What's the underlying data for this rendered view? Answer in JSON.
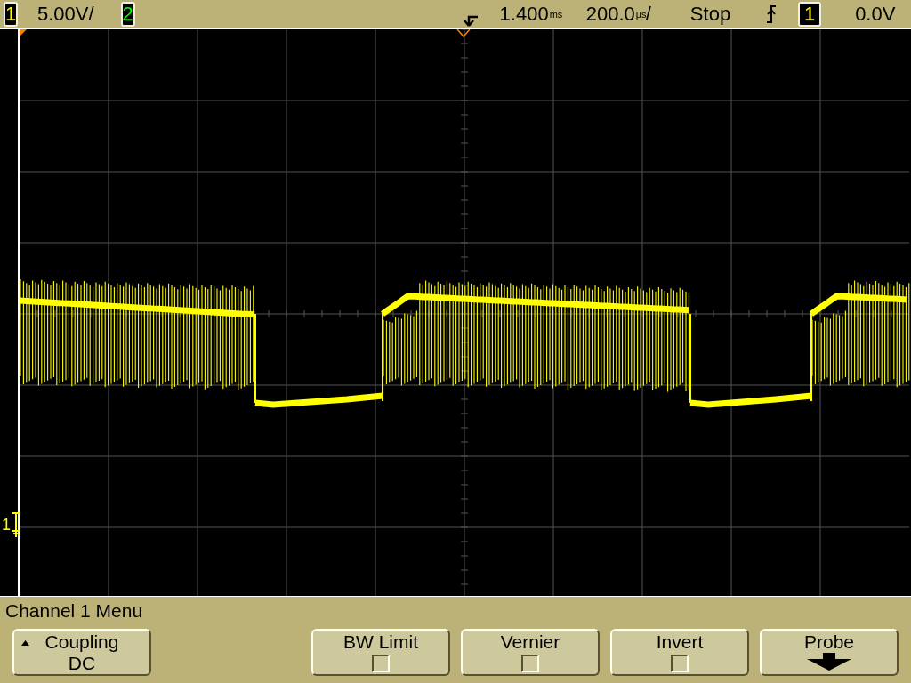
{
  "top_bar": {
    "channels": [
      {
        "label": "1",
        "scale": "5.00V/"
      },
      {
        "label": "2"
      }
    ],
    "delay": {
      "value": "1.400",
      "unit": "ms"
    },
    "timebase": {
      "value": "200.0",
      "unit": "µs",
      "suffix": "/"
    },
    "run_state": "Stop",
    "trigger": {
      "source": "1",
      "level": "0.0V"
    }
  },
  "display": {
    "ground_marker": "1"
  },
  "menu": {
    "title": "Channel 1 Menu",
    "softkeys": [
      {
        "kind": "value",
        "label": "Coupling",
        "value": "DC"
      },
      {
        "kind": "empty"
      },
      {
        "kind": "checkbox",
        "label": "BW Limit",
        "checked": false
      },
      {
        "kind": "checkbox",
        "label": "Vernier",
        "checked": false
      },
      {
        "kind": "checkbox",
        "label": "Invert",
        "checked": false
      },
      {
        "kind": "submenu",
        "label": "Probe"
      }
    ]
  }
}
